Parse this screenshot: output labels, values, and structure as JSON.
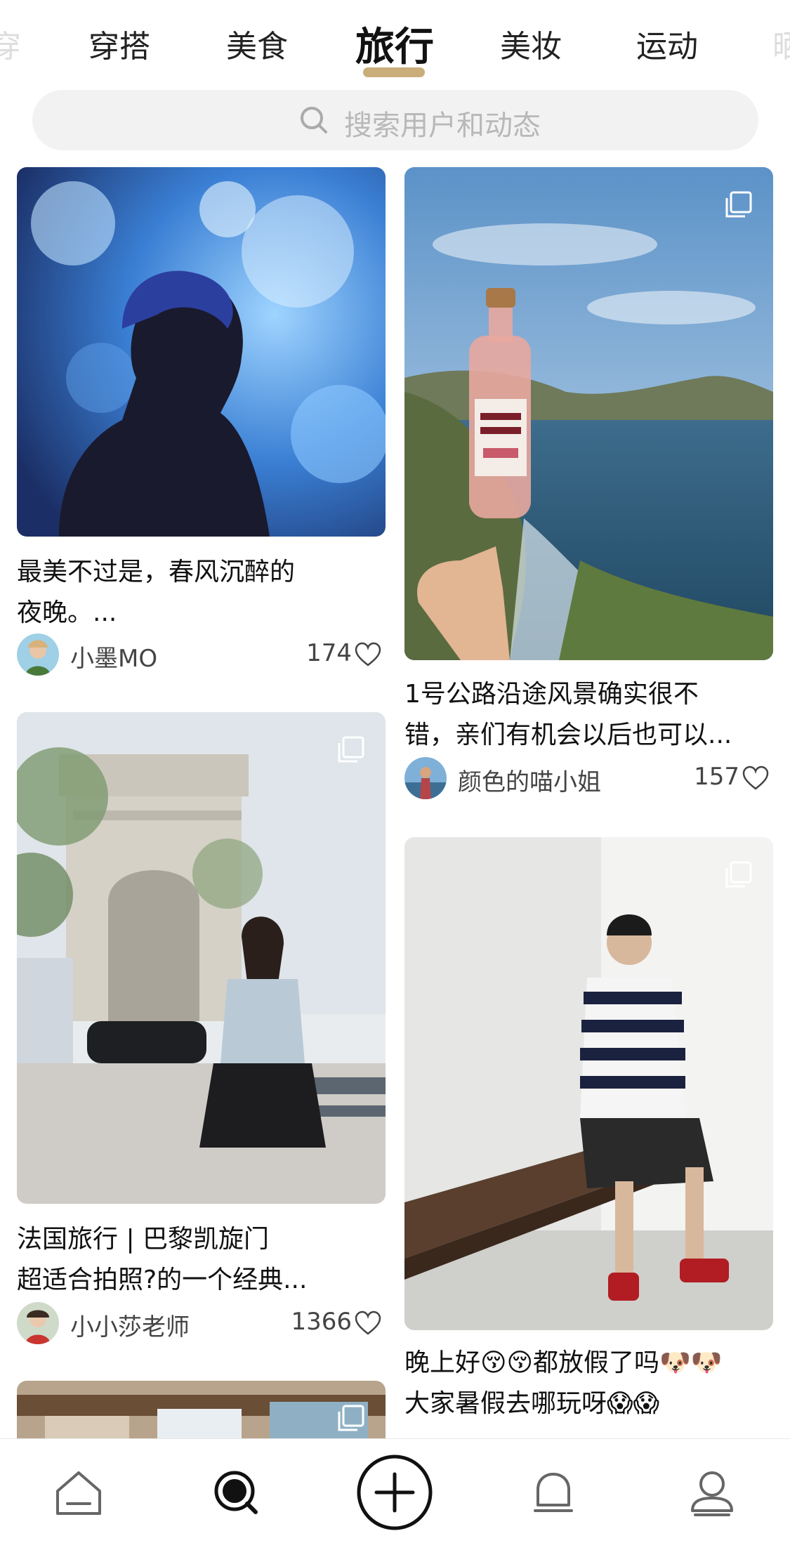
{
  "tabs": {
    "items": [
      {
        "label": "穿搭"
      },
      {
        "label": "美食"
      },
      {
        "label": "旅行"
      },
      {
        "label": "美妆"
      },
      {
        "label": "运动"
      }
    ],
    "active_index": 2,
    "accent_color": "#c9ad7a"
  },
  "search": {
    "placeholder": "搜索用户和动态",
    "icon": "search-icon"
  },
  "feed": {
    "left": [
      {
        "title_line1": "最美不过是，春风沉醉的",
        "title_line2": "夜晚。...",
        "author": "小墨MO",
        "likes": "174",
        "multi_image": false
      },
      {
        "title_line1": "法国旅行 | 巴黎凯旋门",
        "title_line2": "超适合拍照?的一个经典...",
        "author": "小小莎老师",
        "likes": "1366",
        "multi_image": true
      },
      {
        "multi_image": true
      }
    ],
    "right": [
      {
        "title_line1": "1号公路沿途风景确实很不",
        "title_line2": "错，亲们有机会以后也可以...",
        "author": "颜色的喵小姐",
        "likes": "157",
        "multi_image": true
      },
      {
        "title_line1": "晚上好😚😚都放假了吗🐶🐶",
        "title_line2": "大家暑假去哪玩呀😱😱",
        "multi_image": true
      }
    ]
  },
  "bottom_nav": {
    "items": [
      {
        "icon": "home-icon"
      },
      {
        "icon": "discover-icon",
        "active": true
      },
      {
        "icon": "plus-icon"
      },
      {
        "icon": "notification-bell-icon"
      },
      {
        "icon": "profile-icon"
      }
    ]
  }
}
